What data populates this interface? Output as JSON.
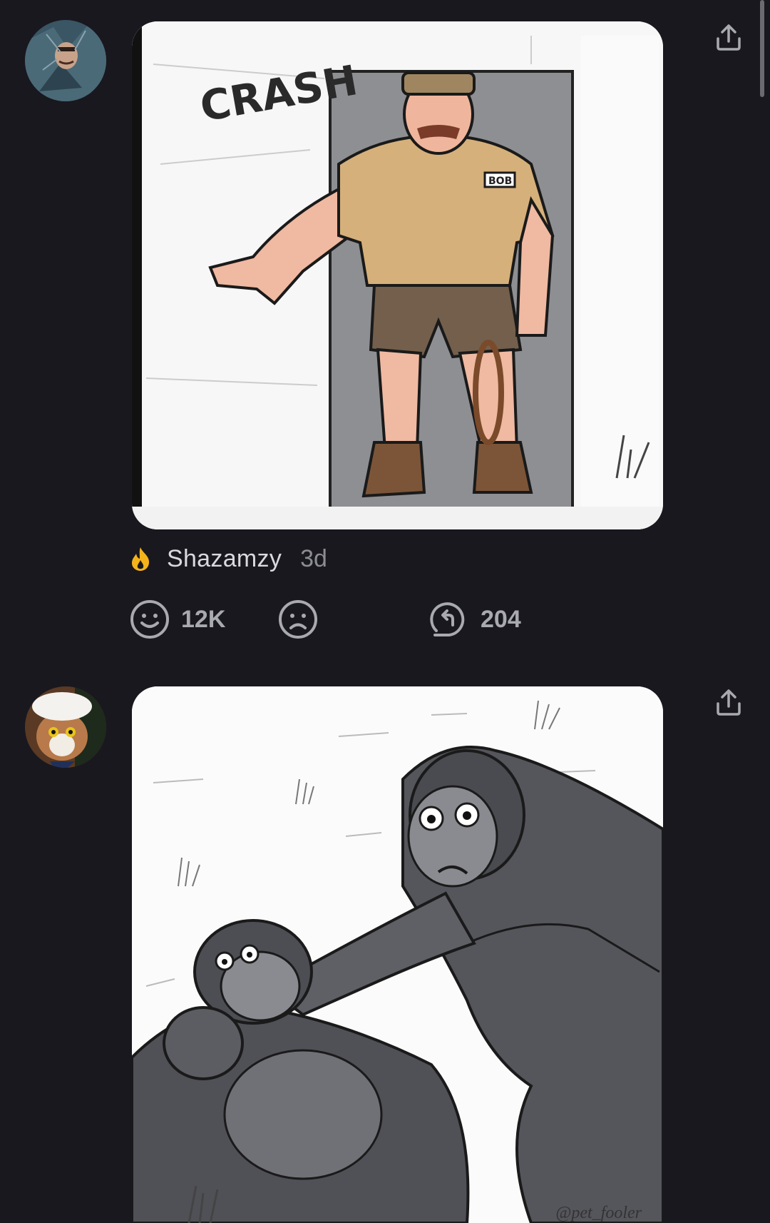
{
  "posts": [
    {
      "avatar_icon": "user-avatar-icon",
      "image_text": "CRASH",
      "badge_text": "BOB",
      "badge_icon": "fire-icon",
      "username": "Shazamzy",
      "timestamp": "3d",
      "reactions": {
        "smile_icon": "smile-icon",
        "smile_count": "12K",
        "frown_icon": "frown-icon",
        "reply_icon": "reply-icon",
        "reply_count": "204"
      },
      "share_icon": "share-icon"
    },
    {
      "avatar_icon": "cat-avatar-icon",
      "watermark": "@pet_fooler",
      "share_icon": "share-icon"
    }
  ],
  "colors": {
    "background": "#19181f",
    "fire": "#f5b31b",
    "text_primary": "#d9d9de",
    "text_muted": "#8c8c93",
    "icon": "#a9a9b0"
  }
}
